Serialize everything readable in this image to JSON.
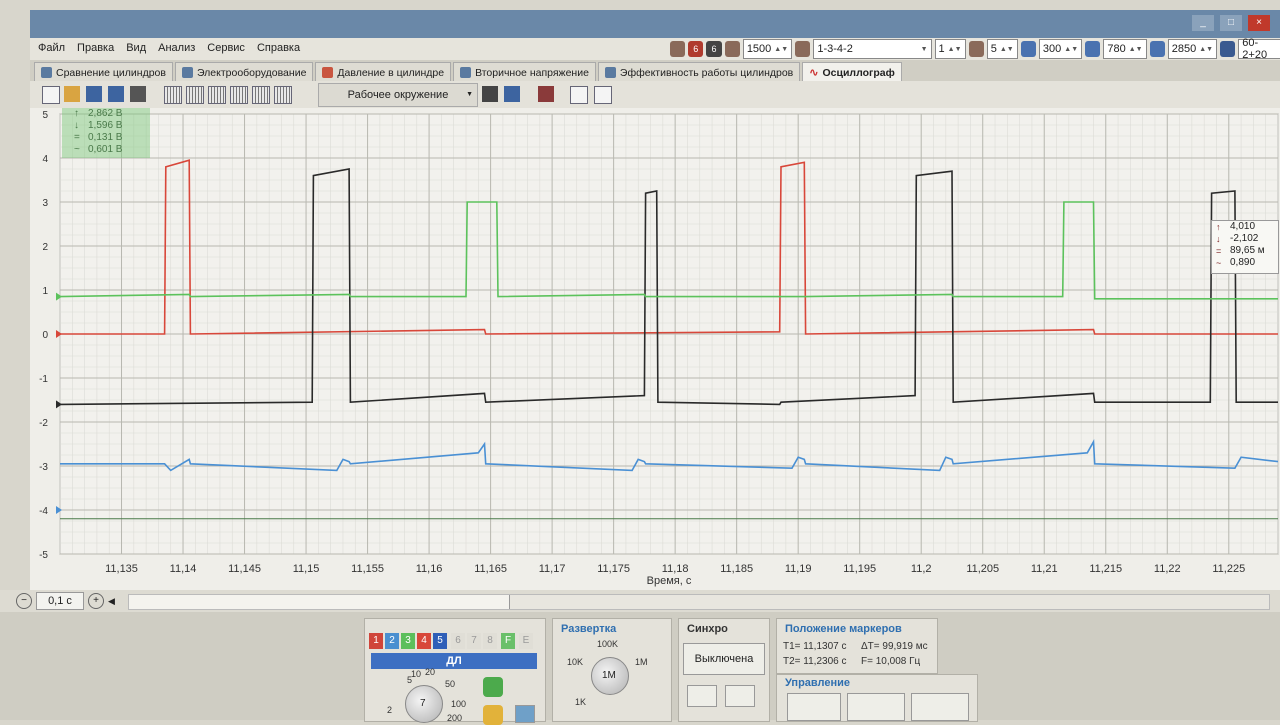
{
  "window": {
    "title": "",
    "buttons": [
      "_",
      "□",
      "×"
    ]
  },
  "menu": {
    "items": [
      "Файл",
      "Правка",
      "Вид",
      "Анализ",
      "Сервис",
      "Справка"
    ]
  },
  "controls": {
    "rpm": "1500",
    "firing_order": "1-3-4-2",
    "cylinder": "1",
    "cyl_count": "5",
    "val1": "300",
    "val2": "780",
    "val3": "2850",
    "preset": "60-2+20"
  },
  "tabs": [
    {
      "label": "Сравнение цилиндров"
    },
    {
      "label": "Электрооборудование"
    },
    {
      "label": "Давление в цилиндре"
    },
    {
      "label": "Вторичное напряжение"
    },
    {
      "label": "Эффективность работы цилиндров"
    },
    {
      "label": "Осциллограф"
    }
  ],
  "toolbar": {
    "environment": "Рабочее окружение"
  },
  "legend": [
    {
      "symbol": "↑",
      "value": "2,862 В"
    },
    {
      "symbol": "↓",
      "value": "1,596 В"
    },
    {
      "symbol": "=",
      "value": "0,131 В"
    },
    {
      "symbol": "~",
      "value": "0,601 В"
    }
  ],
  "marker_box": [
    {
      "symbol": "↑",
      "value": "4,010"
    },
    {
      "symbol": "↓",
      "value": "-2,102"
    },
    {
      "symbol": "=",
      "value": "89,65 м"
    },
    {
      "symbol": "~",
      "value": "0,890"
    }
  ],
  "status": {
    "zoom": "0,1 с"
  },
  "bottom": {
    "channels": [
      "1",
      "2",
      "3",
      "4",
      "5",
      "6",
      "7",
      "8",
      "F",
      "E"
    ],
    "channel_label": "ДЛ",
    "knob_scale": [
      "5",
      "10",
      "20",
      "50",
      "100",
      "200",
      "2"
    ],
    "knob_value": "7",
    "sweep": {
      "title": "Развертка",
      "labels": [
        "100K",
        "10K",
        "1M",
        "1K"
      ],
      "value": "1M"
    },
    "sync": {
      "title": "Синхро",
      "value": "Выключена"
    },
    "markers": {
      "title": "Положение маркеров",
      "t1": "Т1= 11,1307 с",
      "t2": "Т2= 11,2306 с",
      "dt": "ΔТ= 99,919 мс",
      "f": "F= 10,008 Гц"
    },
    "control": {
      "title": "Управление"
    }
  },
  "chart_data": {
    "type": "line",
    "title": "",
    "xlabel": "Время, с",
    "ylabel": "",
    "xlim": [
      11.13,
      11.229
    ],
    "ylim": [
      -5,
      5
    ],
    "grid": true,
    "x_ticks": [
      "11,135",
      "11,14",
      "11,145",
      "11,15",
      "11,155",
      "11,16",
      "11,165",
      "11,17",
      "11,175",
      "11,18",
      "11,185",
      "11,19",
      "11,195",
      "11,2",
      "11,205",
      "11,21",
      "11,215",
      "11,22",
      "11,225"
    ],
    "y_ticks": [
      "5",
      "4",
      "3",
      "2",
      "1",
      "0",
      "-1",
      "-2",
      "-3",
      "-4",
      "-5"
    ],
    "x_tick_values": [
      11.135,
      11.14,
      11.145,
      11.15,
      11.155,
      11.16,
      11.165,
      11.17,
      11.175,
      11.18,
      11.185,
      11.19,
      11.195,
      11.2,
      11.205,
      11.21,
      11.215,
      11.22,
      11.225
    ],
    "y_tick_values": [
      5,
      4,
      3,
      2,
      1,
      0,
      -1,
      -2,
      -3,
      -4,
      -5
    ],
    "series": [
      {
        "color": "#d8473a",
        "x": [
          11.13,
          11.1385,
          11.1386,
          11.1405,
          11.1406,
          11.1645,
          11.1646,
          11.1885,
          11.1886,
          11.1905,
          11.1906,
          11.214,
          11.2141,
          11.229
        ],
        "y": [
          0,
          0,
          3.8,
          3.95,
          0,
          0.1,
          0,
          0.05,
          3.8,
          3.9,
          0,
          0.1,
          0,
          0
        ]
      },
      {
        "color": "#2a2a2a",
        "x": [
          11.13,
          11.1505,
          11.1506,
          11.1535,
          11.1536,
          11.1645,
          11.1646,
          11.1775,
          11.1776,
          11.1785,
          11.1786,
          11.1885,
          11.1886,
          11.1995,
          11.1996,
          11.2025,
          11.2026,
          11.214,
          11.2141,
          11.2235,
          11.2236,
          11.2255,
          11.2256,
          11.229
        ],
        "y": [
          -1.6,
          -1.55,
          3.6,
          3.75,
          -1.55,
          -1.35,
          -1.55,
          -1.4,
          3.2,
          3.25,
          -1.55,
          -1.6,
          -1.55,
          -1.4,
          3.6,
          3.7,
          -1.55,
          -1.35,
          -1.55,
          -1.55,
          3.2,
          3.25,
          -1.55,
          -1.55
        ]
      },
      {
        "color": "#5cc25c",
        "x": [
          11.13,
          11.1405,
          11.1406,
          11.1535,
          11.1536,
          11.163,
          11.1631,
          11.1655,
          11.1656,
          11.1775,
          11.1776,
          11.1905,
          11.1906,
          11.2025,
          11.2026,
          11.2115,
          11.2116,
          11.214,
          11.2141,
          11.229
        ],
        "y": [
          0.85,
          0.9,
          0.85,
          0.9,
          0.85,
          0.85,
          3.0,
          3.0,
          0.85,
          0.9,
          0.85,
          0.85,
          0.85,
          0.9,
          0.85,
          0.85,
          3.0,
          3.0,
          0.8,
          0.8
        ]
      },
      {
        "color": "#4a90d4",
        "x": [
          11.13,
          11.1385,
          11.139,
          11.1405,
          11.1406,
          11.1525,
          11.153,
          11.1535,
          11.1536,
          11.164,
          11.1645,
          11.1646,
          11.1765,
          11.177,
          11.1775,
          11.1776,
          11.1895,
          11.19,
          11.1905,
          11.1906,
          11.2015,
          11.202,
          11.2025,
          11.2026,
          11.2135,
          11.214,
          11.2141,
          11.2255,
          11.226,
          11.229
        ],
        "y": [
          -2.95,
          -2.95,
          -3.1,
          -2.85,
          -2.95,
          -3.1,
          -2.85,
          -2.9,
          -2.95,
          -2.7,
          -2.5,
          -2.95,
          -3.1,
          -2.85,
          -2.9,
          -2.95,
          -3.05,
          -2.8,
          -2.85,
          -2.95,
          -3.1,
          -2.8,
          -2.85,
          -2.95,
          -2.7,
          -2.45,
          -2.95,
          -3.05,
          -2.8,
          -2.9
        ]
      }
    ]
  }
}
